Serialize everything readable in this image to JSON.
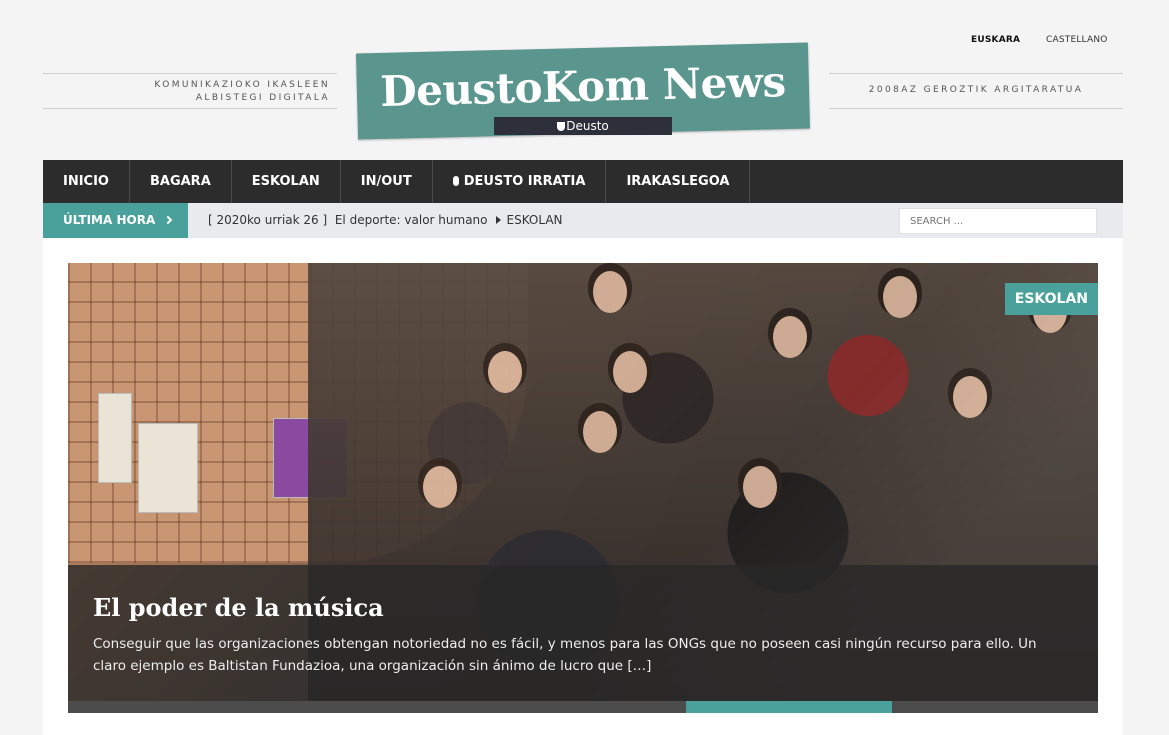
{
  "languages": {
    "active": "EUSKARA",
    "other": "CASTELLANO"
  },
  "header": {
    "tagline_left_1": "KOMUNIKAZIOKO IKASLEEN",
    "tagline_left_2": "ALBISTEGI DIGITALA",
    "tagline_right": "2008AZ GEROZTIK ARGITARATUA",
    "logo_title": "DeustoKom News",
    "logo_sub": "Deusto"
  },
  "nav": {
    "items": [
      "INICIO",
      "BAGARA",
      "ESKOLAN",
      "IN/OUT",
      "DEUSTO IRRATIA",
      "IRAKASLEGOA"
    ]
  },
  "ticker": {
    "label": "ÚLTIMA HORA",
    "date": "[ 2020ko urriak 26 ]",
    "headline": "El deporte: valor humano",
    "category": "ESKOLAN"
  },
  "search": {
    "placeholder": "SEARCH ..."
  },
  "featured": {
    "category": "ESKOLAN",
    "title": "El poder de la música",
    "excerpt": "Conseguir que las organizaciones obtengan notoriedad no es fácil, y menos para las ONGs que no poseen casi ningún recurso para ello. Un claro ejemplo es Baltistan Fundazioa,  una organización sin ánimo de lucro que […]",
    "slide_progress": {
      "start": 0.6,
      "end": 0.8
    }
  },
  "colors": {
    "accent": "#4aa19c",
    "logo": "#5a958e",
    "nav": "#2c2c2c"
  }
}
